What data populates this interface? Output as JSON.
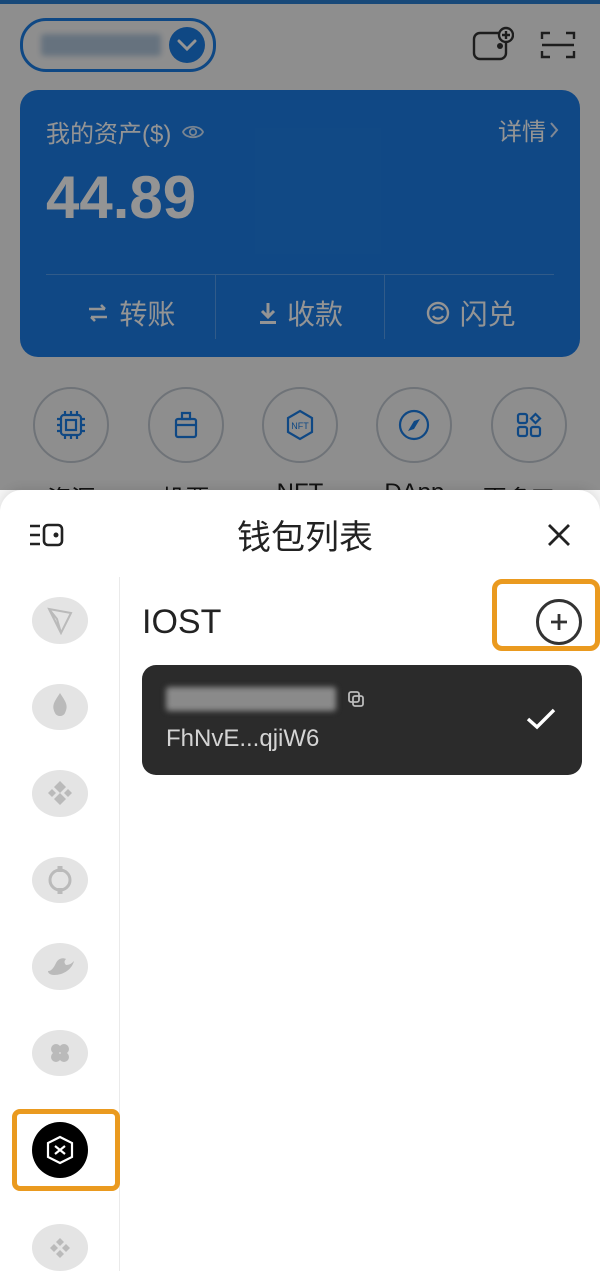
{
  "header": {
    "wallet_name_blurred": true
  },
  "asset": {
    "label": "我的资产($)",
    "amount": "44.89",
    "detail": "详情",
    "actions": {
      "transfer": "转账",
      "receive": "收款",
      "swap": "闪兑"
    }
  },
  "shortcuts": {
    "resource": "资源",
    "vote": "投票",
    "nft": "NFT",
    "dapp": "DApp",
    "more": "更多工..."
  },
  "sheet": {
    "title": "钱包列表",
    "chain_name": "IOST",
    "wallet": {
      "address": "FhNvE...qjiW6",
      "selected": true
    }
  }
}
